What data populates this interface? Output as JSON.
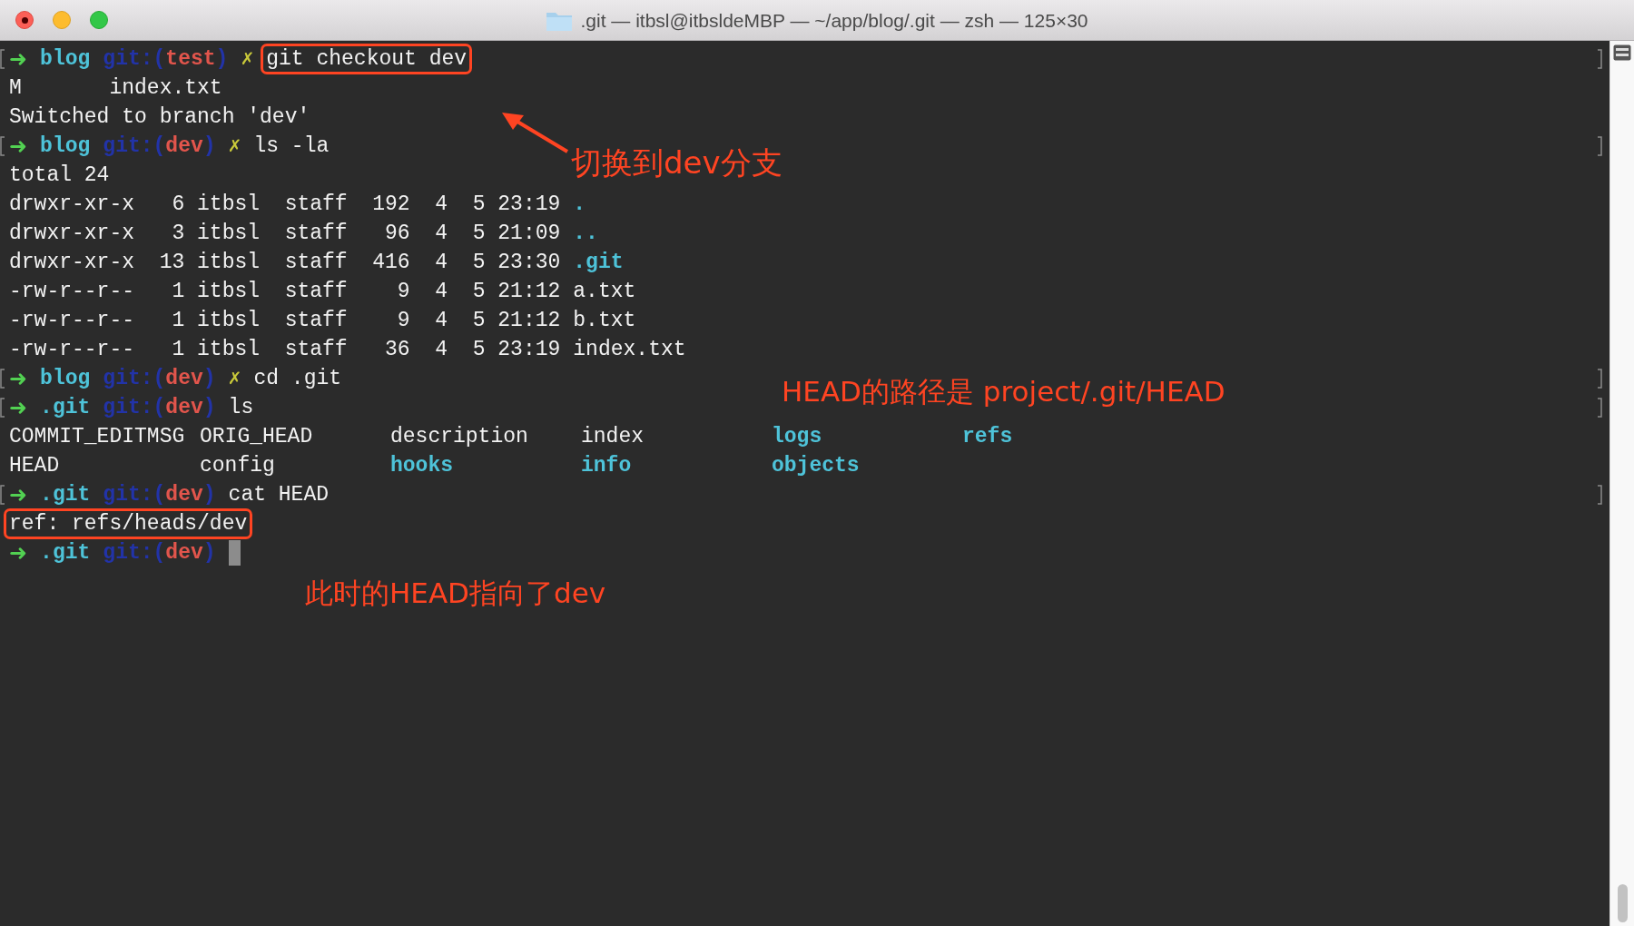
{
  "window": {
    "title": ".git — itbsl@itbsldeMBP — ~/app/blog/.git — zsh — 125×30"
  },
  "lines": [
    {
      "kind": "prompt",
      "marked": true,
      "arrow": "➜",
      "dir": "blog",
      "vcs": "git:(",
      "branch": "test",
      "vcs_close": ")",
      "dirty_mark": "✗",
      "command": "git checkout dev",
      "boxed": true
    },
    {
      "kind": "output",
      "segments": [
        {
          "text": "M       index.txt",
          "kind": "plain"
        }
      ]
    },
    {
      "kind": "output",
      "segments": [
        {
          "text": "Switched to branch 'dev'",
          "kind": "plain"
        }
      ]
    },
    {
      "kind": "prompt",
      "marked": true,
      "arrow": "➜",
      "dir": "blog",
      "vcs": "git:(",
      "branch": "dev",
      "vcs_close": ")",
      "dirty_mark": "✗",
      "command": "ls -la"
    },
    {
      "kind": "output",
      "segments": [
        {
          "text": "total 24",
          "kind": "plain"
        }
      ]
    },
    {
      "kind": "output",
      "segments": [
        {
          "text": "drwxr-xr-x   6 itbsl  staff  192  4  5 23:19",
          "kind": "plain"
        },
        {
          "text": ".",
          "kind": "dir"
        }
      ]
    },
    {
      "kind": "output",
      "segments": [
        {
          "text": "drwxr-xr-x   3 itbsl  staff   96  4  5 21:09",
          "kind": "plain"
        },
        {
          "text": "..",
          "kind": "dir"
        }
      ]
    },
    {
      "kind": "output",
      "segments": [
        {
          "text": "drwxr-xr-x  13 itbsl  staff  416  4  5 23:30",
          "kind": "plain"
        },
        {
          "text": ".git",
          "kind": "dir"
        }
      ]
    },
    {
      "kind": "output",
      "segments": [
        {
          "text": "-rw-r--r--   1 itbsl  staff    9  4  5 21:12",
          "kind": "plain"
        },
        {
          "text": "a.txt",
          "kind": "plain"
        }
      ]
    },
    {
      "kind": "output",
      "segments": [
        {
          "text": "-rw-r--r--   1 itbsl  staff    9  4  5 21:12",
          "kind": "plain"
        },
        {
          "text": "b.txt",
          "kind": "plain"
        }
      ]
    },
    {
      "kind": "output",
      "segments": [
        {
          "text": "-rw-r--r--   1 itbsl  staff   36  4  5 23:19",
          "kind": "plain"
        },
        {
          "text": "index.txt",
          "kind": "plain"
        }
      ]
    },
    {
      "kind": "prompt",
      "marked": true,
      "arrow": "➜",
      "dir": "blog",
      "vcs": "git:(",
      "branch": "dev",
      "vcs_close": ")",
      "dirty_mark": "✗",
      "command": "cd .git"
    },
    {
      "kind": "prompt",
      "marked": true,
      "arrow": "➜",
      "dir": ".git",
      "vcs": "git:(",
      "branch": "dev",
      "vcs_close": ")",
      "command": "ls"
    },
    {
      "kind": "columns",
      "items": [
        {
          "text": "COMMIT_EDITMSG",
          "kind": "plain"
        },
        {
          "text": "ORIG_HEAD",
          "kind": "plain"
        },
        {
          "text": "description",
          "kind": "plain"
        },
        {
          "text": "index",
          "kind": "plain"
        },
        {
          "text": "logs",
          "kind": "dir"
        },
        {
          "text": "refs",
          "kind": "dir"
        }
      ]
    },
    {
      "kind": "columns",
      "items": [
        {
          "text": "HEAD",
          "kind": "plain"
        },
        {
          "text": "config",
          "kind": "plain"
        },
        {
          "text": "hooks",
          "kind": "dir"
        },
        {
          "text": "info",
          "kind": "dir"
        },
        {
          "text": "objects",
          "kind": "dir"
        }
      ]
    },
    {
      "kind": "prompt",
      "marked": true,
      "arrow": "➜",
      "dir": ".git",
      "vcs": "git:(",
      "branch": "dev",
      "vcs_close": ")",
      "command": "cat HEAD"
    },
    {
      "kind": "output",
      "boxed": true,
      "segments": [
        {
          "text": "ref: refs/heads/dev",
          "kind": "plain"
        }
      ]
    },
    {
      "kind": "prompt",
      "marked": false,
      "cursor": true,
      "arrow": "➜",
      "dir": ".git",
      "vcs": "git:(",
      "branch": "dev",
      "vcs_close": ")"
    }
  ],
  "annotations": [
    {
      "kind": "arrow_label",
      "text": "切换到dev分支"
    },
    {
      "kind": "label",
      "text": "HEAD的路径是 project/.git/HEAD"
    },
    {
      "kind": "label",
      "text": "此时的HEAD指向了dev"
    }
  ]
}
